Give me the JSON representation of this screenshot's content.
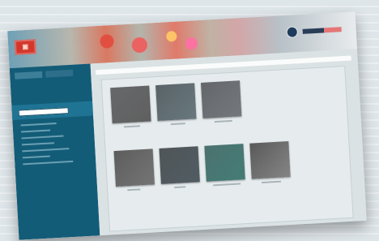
{
  "ui": {
    "header": {},
    "sidebar": {},
    "main": {}
  }
}
